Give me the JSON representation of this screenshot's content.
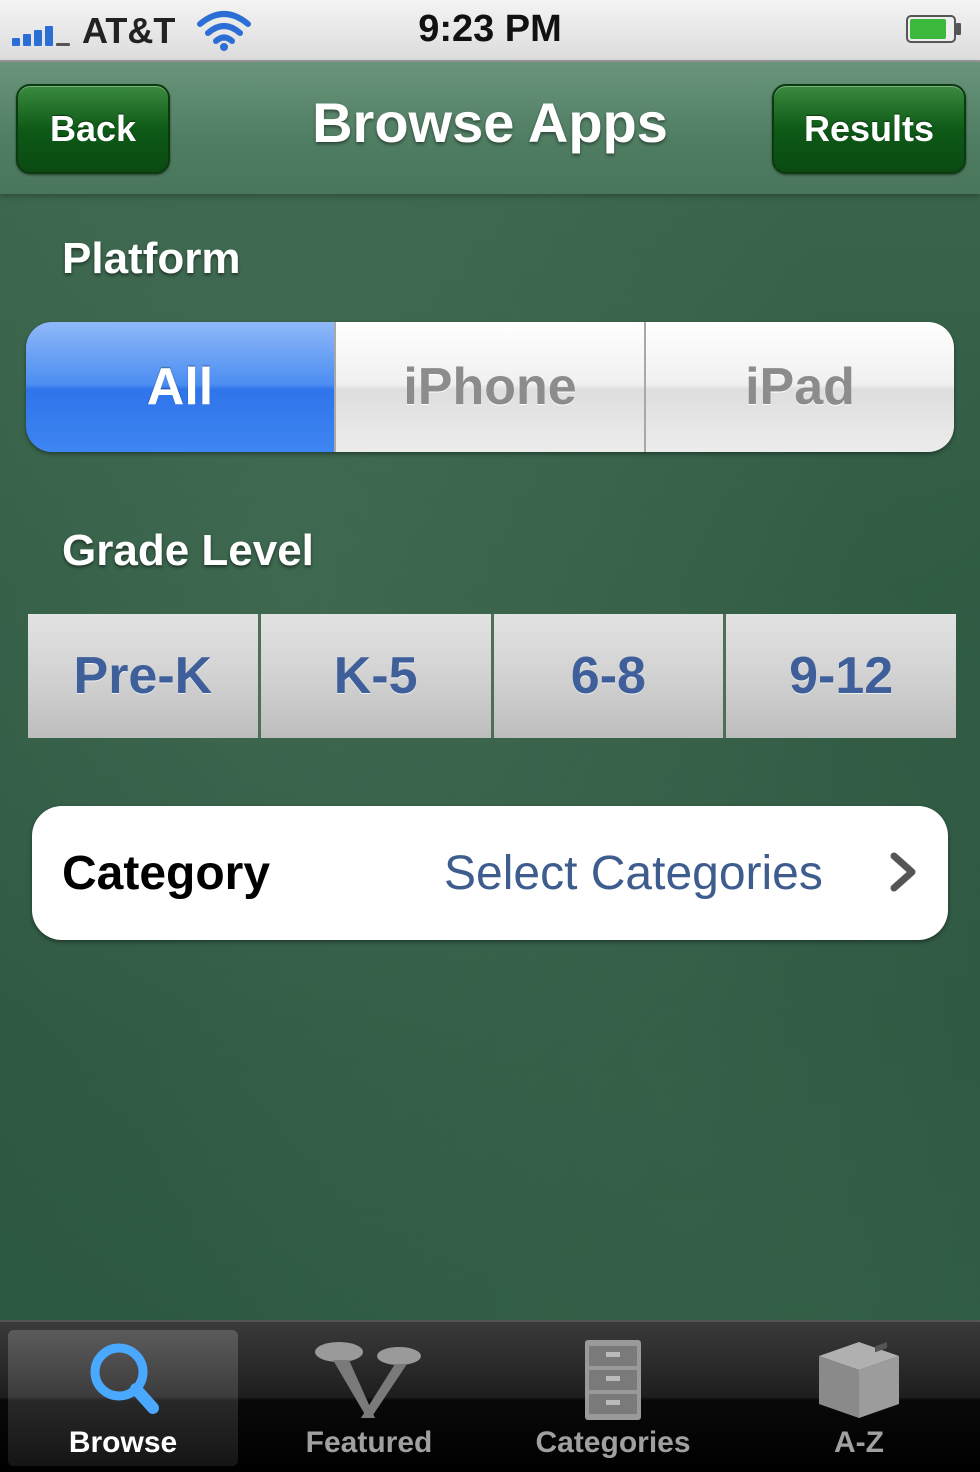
{
  "status_bar": {
    "carrier": "AT&T",
    "time": "9:23 PM"
  },
  "navbar": {
    "back_label": "Back",
    "title": "Browse Apps",
    "results_label": "Results"
  },
  "platform": {
    "label": "Platform",
    "options": [
      "All",
      "iPhone",
      "iPad"
    ],
    "selected": "All"
  },
  "grade_level": {
    "label": "Grade Level",
    "options": [
      "Pre-K",
      "K-5",
      "6-8",
      "9-12"
    ]
  },
  "category": {
    "label": "Category",
    "value": "Select Categories"
  },
  "tabs": [
    {
      "label": "Browse",
      "icon": "search-icon",
      "active": true
    },
    {
      "label": "Featured",
      "icon": "featured-icon",
      "active": false
    },
    {
      "label": "Categories",
      "icon": "cabinet-icon",
      "active": false
    },
    {
      "label": "A-Z",
      "icon": "box-icon",
      "active": false
    }
  ],
  "colors": {
    "accent_blue": "#2f74ea",
    "nav_green": "#0e5a17",
    "link_blue": "#3e5c8e"
  }
}
